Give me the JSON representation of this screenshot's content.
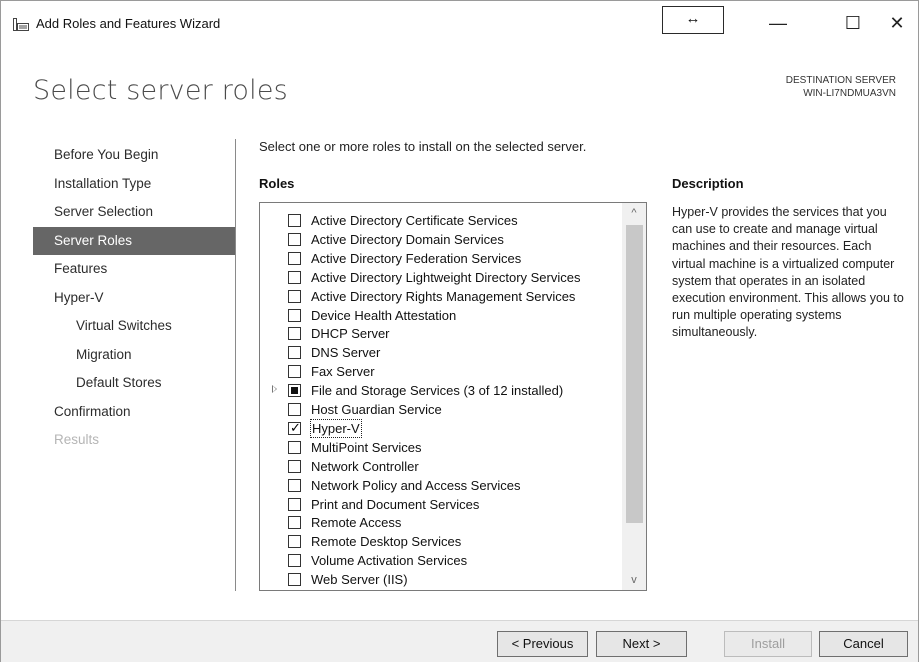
{
  "window": {
    "title": "Add Roles and Features Wizard",
    "resize_glyph": "↔",
    "minimize_glyph": "—",
    "maximize_glyph": "☐",
    "close_glyph": "✕"
  },
  "header": {
    "heading": "Select server roles",
    "destination_label": "DESTINATION SERVER",
    "destination_value": "WIN-LI7NDMUA3VN"
  },
  "nav": {
    "items": [
      {
        "label": "Before You Begin",
        "state": "normal"
      },
      {
        "label": "Installation Type",
        "state": "normal"
      },
      {
        "label": "Server Selection",
        "state": "normal"
      },
      {
        "label": "Server Roles",
        "state": "active"
      },
      {
        "label": "Features",
        "state": "normal"
      },
      {
        "label": "Hyper-V",
        "state": "normal"
      },
      {
        "label": "Virtual Switches",
        "state": "sub"
      },
      {
        "label": "Migration",
        "state": "sub"
      },
      {
        "label": "Default Stores",
        "state": "sub"
      },
      {
        "label": "Confirmation",
        "state": "normal"
      },
      {
        "label": "Results",
        "state": "disabled"
      }
    ]
  },
  "content": {
    "instruction": "Select one or more roles to install on the selected server.",
    "roles_label": "Roles",
    "roles": [
      {
        "label": "Active Directory Certificate Services",
        "state": "unchecked"
      },
      {
        "label": "Active Directory Domain Services",
        "state": "unchecked"
      },
      {
        "label": "Active Directory Federation Services",
        "state": "unchecked"
      },
      {
        "label": "Active Directory Lightweight Directory Services",
        "state": "unchecked"
      },
      {
        "label": "Active Directory Rights Management Services",
        "state": "unchecked"
      },
      {
        "label": "Device Health Attestation",
        "state": "unchecked"
      },
      {
        "label": "DHCP Server",
        "state": "unchecked"
      },
      {
        "label": "DNS Server",
        "state": "unchecked"
      },
      {
        "label": "Fax Server",
        "state": "unchecked"
      },
      {
        "label": "File and Storage Services (3 of 12 installed)",
        "state": "partial",
        "expandable": true
      },
      {
        "label": "Host Guardian Service",
        "state": "unchecked"
      },
      {
        "label": "Hyper-V",
        "state": "checked",
        "selected": true
      },
      {
        "label": "MultiPoint Services",
        "state": "unchecked"
      },
      {
        "label": "Network Controller",
        "state": "unchecked"
      },
      {
        "label": "Network Policy and Access Services",
        "state": "unchecked"
      },
      {
        "label": "Print and Document Services",
        "state": "unchecked"
      },
      {
        "label": "Remote Access",
        "state": "unchecked"
      },
      {
        "label": "Remote Desktop Services",
        "state": "unchecked"
      },
      {
        "label": "Volume Activation Services",
        "state": "unchecked"
      },
      {
        "label": "Web Server (IIS)",
        "state": "unchecked"
      }
    ],
    "scroll_up_glyph": "^",
    "scroll_down_glyph": "v",
    "description_label": "Description",
    "description_text": "Hyper-V provides the services that you can use to create and manage virtual machines and their resources. Each virtual machine is a virtualized computer system that operates in an isolated execution environment. This allows you to run multiple operating systems simultaneously."
  },
  "footer": {
    "previous_label": "< Previous",
    "next_label": "Next >",
    "install_label": "Install",
    "cancel_label": "Cancel"
  },
  "colors": {
    "active_nav_bg": "#666666",
    "footer_bg": "#f0f0f0",
    "disabled_text": "#b5b5b5"
  }
}
